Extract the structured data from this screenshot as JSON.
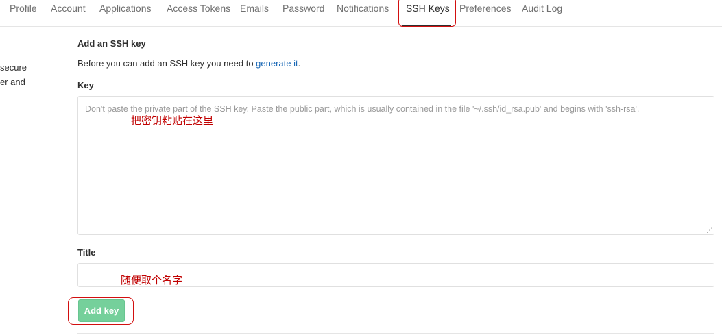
{
  "nav": {
    "items": [
      {
        "label": "Profile"
      },
      {
        "label": "Account"
      },
      {
        "label": "Applications"
      },
      {
        "label": "Access Tokens"
      },
      {
        "label": "Emails"
      },
      {
        "label": "Password"
      },
      {
        "label": "Notifications"
      },
      {
        "label": "SSH Keys",
        "active": true
      },
      {
        "label": "Preferences"
      },
      {
        "label": "Audit Log"
      }
    ]
  },
  "sidebar": {
    "line1": "secure",
    "line2": "er and"
  },
  "form": {
    "section_title": "Add an SSH key",
    "help_prefix": "Before you can add an SSH key you need to ",
    "help_link": "generate it",
    "help_suffix": ".",
    "key_label": "Key",
    "key_placeholder": "Don't paste the private part of the SSH key. Paste the public part, which is usually contained in the file '~/.ssh/id_rsa.pub' and begins with 'ssh-rsa'.",
    "key_value": "",
    "title_label": "Title",
    "title_value": "",
    "submit_label": "Add key"
  },
  "annotations": {
    "key_note": "把密钥粘贴在这里",
    "title_note": "随便取个名字",
    "color": "#d20f0f"
  },
  "colors": {
    "button_green": "#75d09b",
    "link_blue": "#1b69b6"
  }
}
